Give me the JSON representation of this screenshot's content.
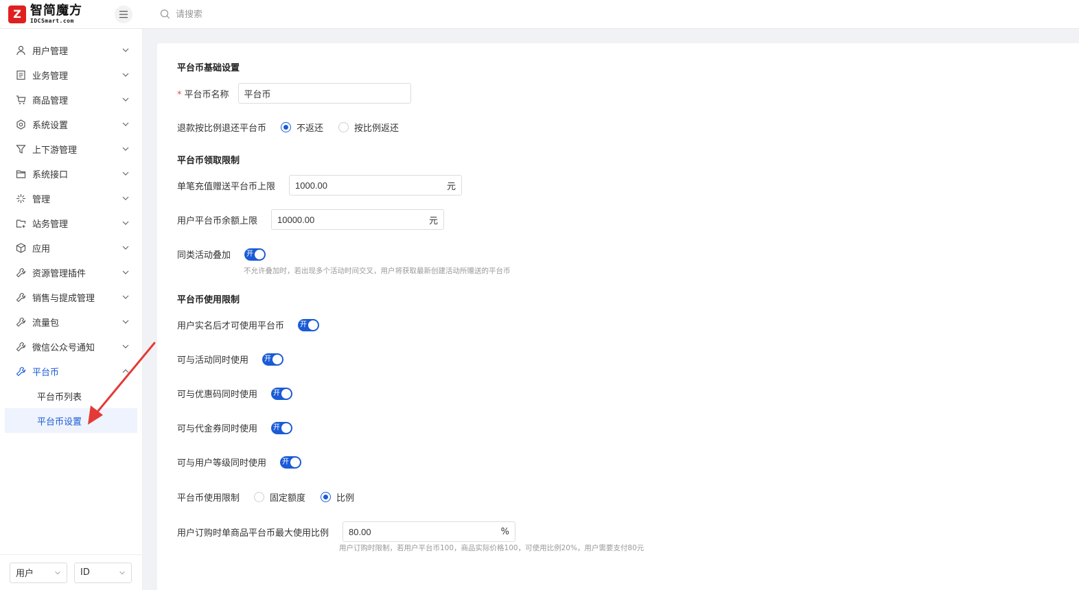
{
  "header": {
    "logo_mark": "Z",
    "logo_name": "智简魔方",
    "logo_sub": "IDCSmart.com",
    "search_placeholder": "请搜索"
  },
  "sidebar": {
    "items": [
      {
        "label": "用户管理",
        "icon": "user-icon"
      },
      {
        "label": "业务管理",
        "icon": "document-icon"
      },
      {
        "label": "商品管理",
        "icon": "cart-icon"
      },
      {
        "label": "系统设置",
        "icon": "settings-icon"
      },
      {
        "label": "上下游管理",
        "icon": "filter-icon"
      },
      {
        "label": "系统接口",
        "icon": "folder-icon"
      },
      {
        "label": "管理",
        "icon": "sparkle-icon"
      },
      {
        "label": "站务管理",
        "icon": "station-icon"
      },
      {
        "label": "应用",
        "icon": "cube-icon"
      },
      {
        "label": "资源管理插件",
        "icon": "wrench-icon"
      },
      {
        "label": "销售与提成管理",
        "icon": "wrench-icon"
      },
      {
        "label": "流量包",
        "icon": "wrench-icon"
      },
      {
        "label": "微信公众号通知",
        "icon": "wrench-icon"
      },
      {
        "label": "平台币",
        "icon": "wrench-icon"
      }
    ],
    "sub_items": [
      "平台币列表",
      "平台币设置"
    ],
    "bottom": {
      "select1": "用户",
      "select2": "ID"
    }
  },
  "main": {
    "basic_title": "平台币基础设置",
    "name_label": "平台币名称",
    "name_value": "平台币",
    "refund_label": "退款按比例退还平台币",
    "refund_opt1": "不返还",
    "refund_opt2": "按比例返还",
    "claim_title": "平台币领取限制",
    "single_label": "单笔充值赠送平台币上限",
    "single_value": "1000.00",
    "single_unit": "元",
    "balance_label": "用户平台币余额上限",
    "balance_value": "10000.00",
    "balance_unit": "元",
    "stack_label": "同类活动叠加",
    "toggle_on": "开",
    "stack_hint": "不允许叠加时，若出现多个活动时间交叉，用户将获取最新创建活动所赠送的平台币",
    "use_title": "平台币使用限制",
    "realname_label": "用户实名后才可使用平台币",
    "activity_label": "可与活动同时使用",
    "coupon_label": "可与优惠码同时使用",
    "voucher_label": "可与代金券同时使用",
    "level_label": "可与用户等级同时使用",
    "limit_label": "平台币使用限制",
    "limit_opt1": "固定额度",
    "limit_opt2": "比例",
    "ratio_label": "用户订购时单商品平台币最大使用比例",
    "ratio_value": "80.00",
    "ratio_unit": "%",
    "ratio_hint": "用户订购时限制，若用户平台币100，商品实际价格100，可使用比例20%，用户需要支付80元"
  },
  "colors": {
    "accent": "#1a5bd6",
    "arrow": "#e53935",
    "required": "#e34d59"
  }
}
